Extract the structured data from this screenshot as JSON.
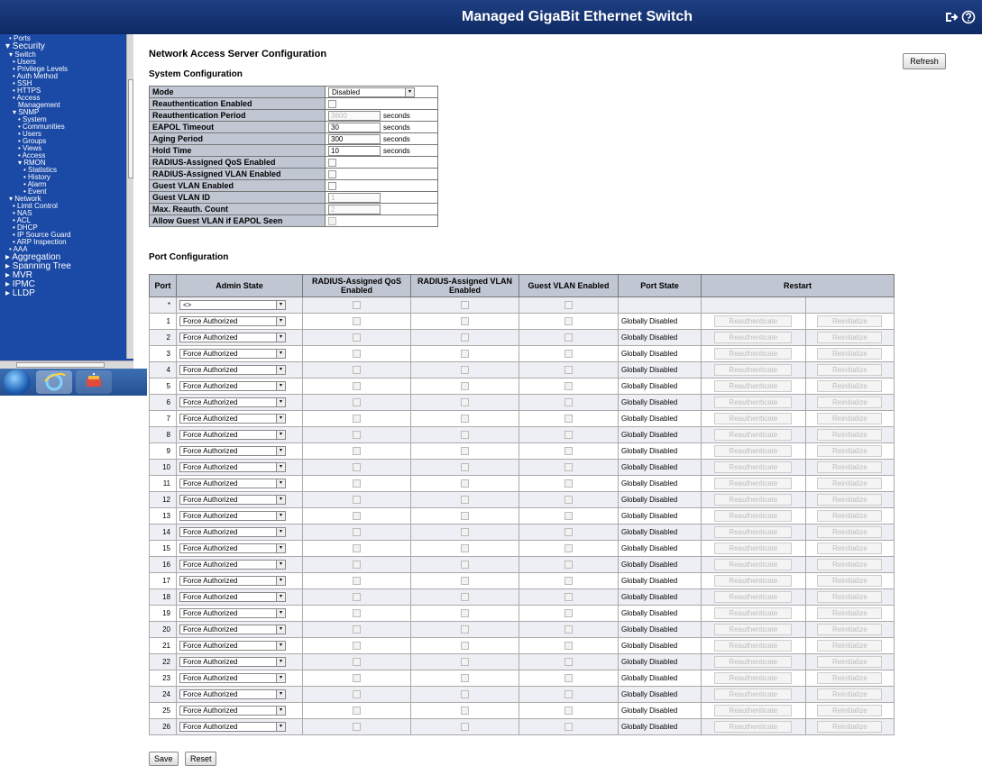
{
  "header": {
    "title": "Managed GigaBit Ethernet Switch"
  },
  "sidebar": {
    "items": [
      {
        "label": "• Ports",
        "level": 1
      },
      {
        "label": "▾ Security",
        "level": 0
      },
      {
        "label": "▾ Switch",
        "level": 1
      },
      {
        "label": "• Users",
        "level": 2
      },
      {
        "label": "• Privilege Levels",
        "level": 2
      },
      {
        "label": "• Auth Method",
        "level": 2
      },
      {
        "label": "• SSH",
        "level": 2
      },
      {
        "label": "• HTTPS",
        "level": 2
      },
      {
        "label": "• Access",
        "level": 2
      },
      {
        "label": "Management",
        "level": 3
      },
      {
        "label": "▾ SNMP",
        "level": 2
      },
      {
        "label": "• System",
        "level": 3
      },
      {
        "label": "• Communities",
        "level": 3
      },
      {
        "label": "• Users",
        "level": 3
      },
      {
        "label": "• Groups",
        "level": 3
      },
      {
        "label": "• Views",
        "level": 3
      },
      {
        "label": "• Access",
        "level": 3
      },
      {
        "label": "▾ RMON",
        "level": 3
      },
      {
        "label": "• Statistics",
        "level": 4
      },
      {
        "label": "• History",
        "level": 4
      },
      {
        "label": "• Alarm",
        "level": 4
      },
      {
        "label": "• Event",
        "level": 4
      },
      {
        "label": "▾ Network",
        "level": 1
      },
      {
        "label": "• Limit Control",
        "level": 2
      },
      {
        "label": "• NAS",
        "level": 2
      },
      {
        "label": "• ACL",
        "level": 2
      },
      {
        "label": "• DHCP",
        "level": 2
      },
      {
        "label": "• IP Source Guard",
        "level": 2
      },
      {
        "label": "• ARP Inspection",
        "level": 2
      },
      {
        "label": "• AAA",
        "level": 1
      },
      {
        "label": "▸ Aggregation",
        "level": 0
      },
      {
        "label": "▸ Spanning Tree",
        "level": 0
      },
      {
        "label": "▸ MVR",
        "level": 0
      },
      {
        "label": "▸ IPMC",
        "level": 0
      },
      {
        "label": "▸ LLDP",
        "level": 0
      }
    ]
  },
  "main": {
    "title": "Network Access Server Configuration",
    "refresh_label": "Refresh",
    "system_heading": "System Configuration",
    "port_heading": "Port Configuration",
    "system_rows": [
      {
        "label": "Mode",
        "type": "select",
        "value": "Disabled"
      },
      {
        "label": "Reauthentication Enabled",
        "type": "checkbox"
      },
      {
        "label": "Reauthentication Period",
        "type": "text",
        "value": "3600",
        "disabled": true,
        "unit": "seconds"
      },
      {
        "label": "EAPOL Timeout",
        "type": "text",
        "value": "30",
        "unit": "seconds"
      },
      {
        "label": "Aging Period",
        "type": "text",
        "value": "300",
        "unit": "seconds"
      },
      {
        "label": "Hold Time",
        "type": "text",
        "value": "10",
        "unit": "seconds"
      },
      {
        "label": "RADIUS-Assigned QoS Enabled",
        "type": "checkbox"
      },
      {
        "label": "RADIUS-Assigned VLAN Enabled",
        "type": "checkbox"
      },
      {
        "label": "Guest VLAN Enabled",
        "type": "checkbox"
      },
      {
        "label": "Guest VLAN ID",
        "type": "text",
        "value": "1",
        "disabled": true
      },
      {
        "label": "Max. Reauth. Count",
        "type": "text",
        "value": "2",
        "disabled": true
      },
      {
        "label": "Allow Guest VLAN if EAPOL Seen",
        "type": "checkbox",
        "disabled": true
      }
    ],
    "port_columns": [
      "Port",
      "Admin State",
      "RADIUS-Assigned QoS Enabled",
      "RADIUS-Assigned VLAN Enabled",
      "Guest VLAN Enabled",
      "Port State",
      "Restart"
    ],
    "wildcard_row": {
      "port": "*",
      "admin_state": "<>"
    },
    "ports": [
      {
        "port": "1",
        "admin_state": "Force Authorized",
        "state": "Globally Disabled"
      },
      {
        "port": "2",
        "admin_state": "Force Authorized",
        "state": "Globally Disabled"
      },
      {
        "port": "3",
        "admin_state": "Force Authorized",
        "state": "Globally Disabled"
      },
      {
        "port": "4",
        "admin_state": "Force Authorized",
        "state": "Globally Disabled"
      },
      {
        "port": "5",
        "admin_state": "Force Authorized",
        "state": "Globally Disabled"
      },
      {
        "port": "6",
        "admin_state": "Force Authorized",
        "state": "Globally Disabled"
      },
      {
        "port": "7",
        "admin_state": "Force Authorized",
        "state": "Globally Disabled"
      },
      {
        "port": "8",
        "admin_state": "Force Authorized",
        "state": "Globally Disabled"
      },
      {
        "port": "9",
        "admin_state": "Force Authorized",
        "state": "Globally Disabled"
      },
      {
        "port": "10",
        "admin_state": "Force Authorized",
        "state": "Globally Disabled"
      },
      {
        "port": "11",
        "admin_state": "Force Authorized",
        "state": "Globally Disabled"
      },
      {
        "port": "12",
        "admin_state": "Force Authorized",
        "state": "Globally Disabled"
      },
      {
        "port": "13",
        "admin_state": "Force Authorized",
        "state": "Globally Disabled"
      },
      {
        "port": "14",
        "admin_state": "Force Authorized",
        "state": "Globally Disabled"
      },
      {
        "port": "15",
        "admin_state": "Force Authorized",
        "state": "Globally Disabled"
      },
      {
        "port": "16",
        "admin_state": "Force Authorized",
        "state": "Globally Disabled"
      },
      {
        "port": "17",
        "admin_state": "Force Authorized",
        "state": "Globally Disabled"
      },
      {
        "port": "18",
        "admin_state": "Force Authorized",
        "state": "Globally Disabled"
      },
      {
        "port": "19",
        "admin_state": "Force Authorized",
        "state": "Globally Disabled"
      },
      {
        "port": "20",
        "admin_state": "Force Authorized",
        "state": "Globally Disabled"
      },
      {
        "port": "21",
        "admin_state": "Force Authorized",
        "state": "Globally Disabled"
      },
      {
        "port": "22",
        "admin_state": "Force Authorized",
        "state": "Globally Disabled"
      },
      {
        "port": "23",
        "admin_state": "Force Authorized",
        "state": "Globally Disabled"
      },
      {
        "port": "24",
        "admin_state": "Force Authorized",
        "state": "Globally Disabled"
      },
      {
        "port": "25",
        "admin_state": "Force Authorized",
        "state": "Globally Disabled"
      },
      {
        "port": "26",
        "admin_state": "Force Authorized",
        "state": "Globally Disabled"
      }
    ],
    "reauth_label": "Reauthenticate",
    "reinit_label": "Reinitialize",
    "save_label": "Save",
    "reset_label": "Reset"
  },
  "colors": {
    "header": "#1e3f83",
    "sidebar": "#1a49a6",
    "table_header": "#c1c6d3"
  },
  "icons": {
    "header": [
      "logout-icon",
      "help-icon"
    ],
    "taskbar": [
      "windows-start-icon",
      "internet-explorer-icon",
      "network-app-icon"
    ]
  }
}
